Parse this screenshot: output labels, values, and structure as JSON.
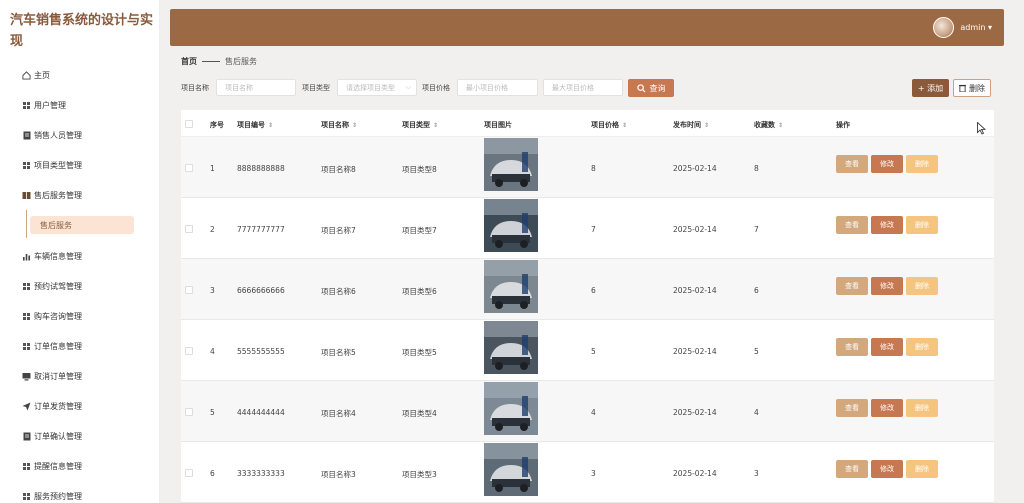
{
  "app": {
    "title": "汽车销售系统的设计与实现"
  },
  "sidebar": {
    "items": [
      {
        "label": "主页",
        "icon": "home-icon"
      },
      {
        "label": "用户管理",
        "icon": "grid-icon"
      },
      {
        "label": "销售人员管理",
        "icon": "doc-icon"
      },
      {
        "label": "项目类型管理",
        "icon": "grid-icon"
      },
      {
        "label": "售后服务管理",
        "icon": "book-icon"
      },
      {
        "label": "车辆信息管理",
        "icon": "bar-chart-icon"
      },
      {
        "label": "预约试驾管理",
        "icon": "grid-icon"
      },
      {
        "label": "购车咨询管理",
        "icon": "grid-icon"
      },
      {
        "label": "订单信息管理",
        "icon": "grid-icon"
      },
      {
        "label": "取消订单管理",
        "icon": "monitor-icon"
      },
      {
        "label": "订单发货管理",
        "icon": "send-icon"
      },
      {
        "label": "订单确认管理",
        "icon": "doc-icon"
      },
      {
        "label": "提醒信息管理",
        "icon": "grid-icon"
      },
      {
        "label": "服务预约管理",
        "icon": "grid-icon"
      }
    ],
    "sub_item": "售后服务"
  },
  "header": {
    "user": "admin ▾"
  },
  "breadcrumb": {
    "home": "首页",
    "current": "售后服务"
  },
  "search": {
    "name_label": "项目名称",
    "name_placeholder": "项目名称",
    "type_label": "项目类型",
    "type_placeholder": "请选择项目类型",
    "price_label": "项目价格",
    "min_placeholder": "最小项目价格",
    "max_placeholder": "最大项目价格",
    "query_label": "查询",
    "add_label": "+ 添加",
    "delete_label": "删除"
  },
  "table": {
    "headers": [
      "序号",
      "项目编号",
      "项目名称",
      "项目类型",
      "项目图片",
      "项目价格",
      "发布时间",
      "收藏数",
      "操作"
    ],
    "rows": [
      {
        "seq": "1",
        "code": "8888888888",
        "name": "项目名称8",
        "type": "项目类型8",
        "price": "8",
        "date": "2025-02-14",
        "fav": "8"
      },
      {
        "seq": "2",
        "code": "7777777777",
        "name": "项目名称7",
        "type": "项目类型7",
        "price": "7",
        "date": "2025-02-14",
        "fav": "7"
      },
      {
        "seq": "3",
        "code": "6666666666",
        "name": "项目名称6",
        "type": "项目类型6",
        "price": "6",
        "date": "2025-02-14",
        "fav": "6"
      },
      {
        "seq": "4",
        "code": "5555555555",
        "name": "项目名称5",
        "type": "项目类型5",
        "price": "5",
        "date": "2025-02-14",
        "fav": "5"
      },
      {
        "seq": "5",
        "code": "4444444444",
        "name": "项目名称4",
        "type": "项目类型4",
        "price": "4",
        "date": "2025-02-14",
        "fav": "4"
      },
      {
        "seq": "6",
        "code": "3333333333",
        "name": "项目名称3",
        "type": "项目类型3",
        "price": "3",
        "date": "2025-02-14",
        "fav": "3"
      }
    ],
    "actions": {
      "view": "查看",
      "edit": "修改",
      "remove": "删除"
    }
  },
  "colors": {
    "header": "#9b6a45",
    "query": "#c87850",
    "add": "#8a5a3a",
    "view": "#d2a87c",
    "edit": "#c87850",
    "remove": "#f5c580"
  }
}
